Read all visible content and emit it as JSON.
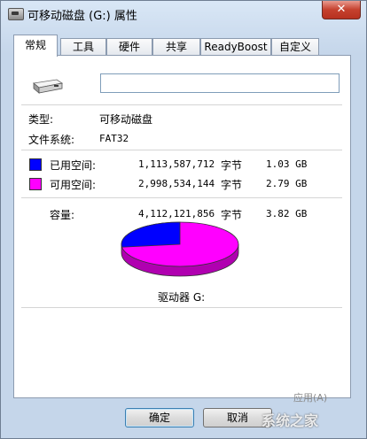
{
  "window": {
    "title": "可移动磁盘 (G:) 属性",
    "close_glyph": "✕"
  },
  "tabs": [
    {
      "label": "常规",
      "active": true
    },
    {
      "label": "工具",
      "active": false
    },
    {
      "label": "硬件",
      "active": false
    },
    {
      "label": "共享",
      "active": false
    },
    {
      "label": "ReadyBoost",
      "active": false
    },
    {
      "label": "自定义",
      "active": false
    }
  ],
  "general": {
    "name_value": "",
    "type_label": "类型:",
    "type_value": "可移动磁盘",
    "fs_label": "文件系统:",
    "fs_value": "FAT32",
    "used": {
      "label": "已用空间:",
      "bytes": "1,113,587,712",
      "unit": "字节",
      "size": "1.03 GB",
      "color": "#0000ff"
    },
    "free": {
      "label": "可用空间:",
      "bytes": "2,998,534,144",
      "unit": "字节",
      "size": "2.79 GB",
      "color": "#ff00ff"
    },
    "capacity": {
      "label": "容量:",
      "bytes": "4,112,121,856",
      "unit": "字节",
      "size": "3.82 GB"
    },
    "used_fraction": 0.2708,
    "drive_label": "驱动器 G:"
  },
  "buttons": {
    "ok": "确定",
    "cancel": "取消",
    "apply": "应用(A)"
  },
  "watermark": "系统之家"
}
